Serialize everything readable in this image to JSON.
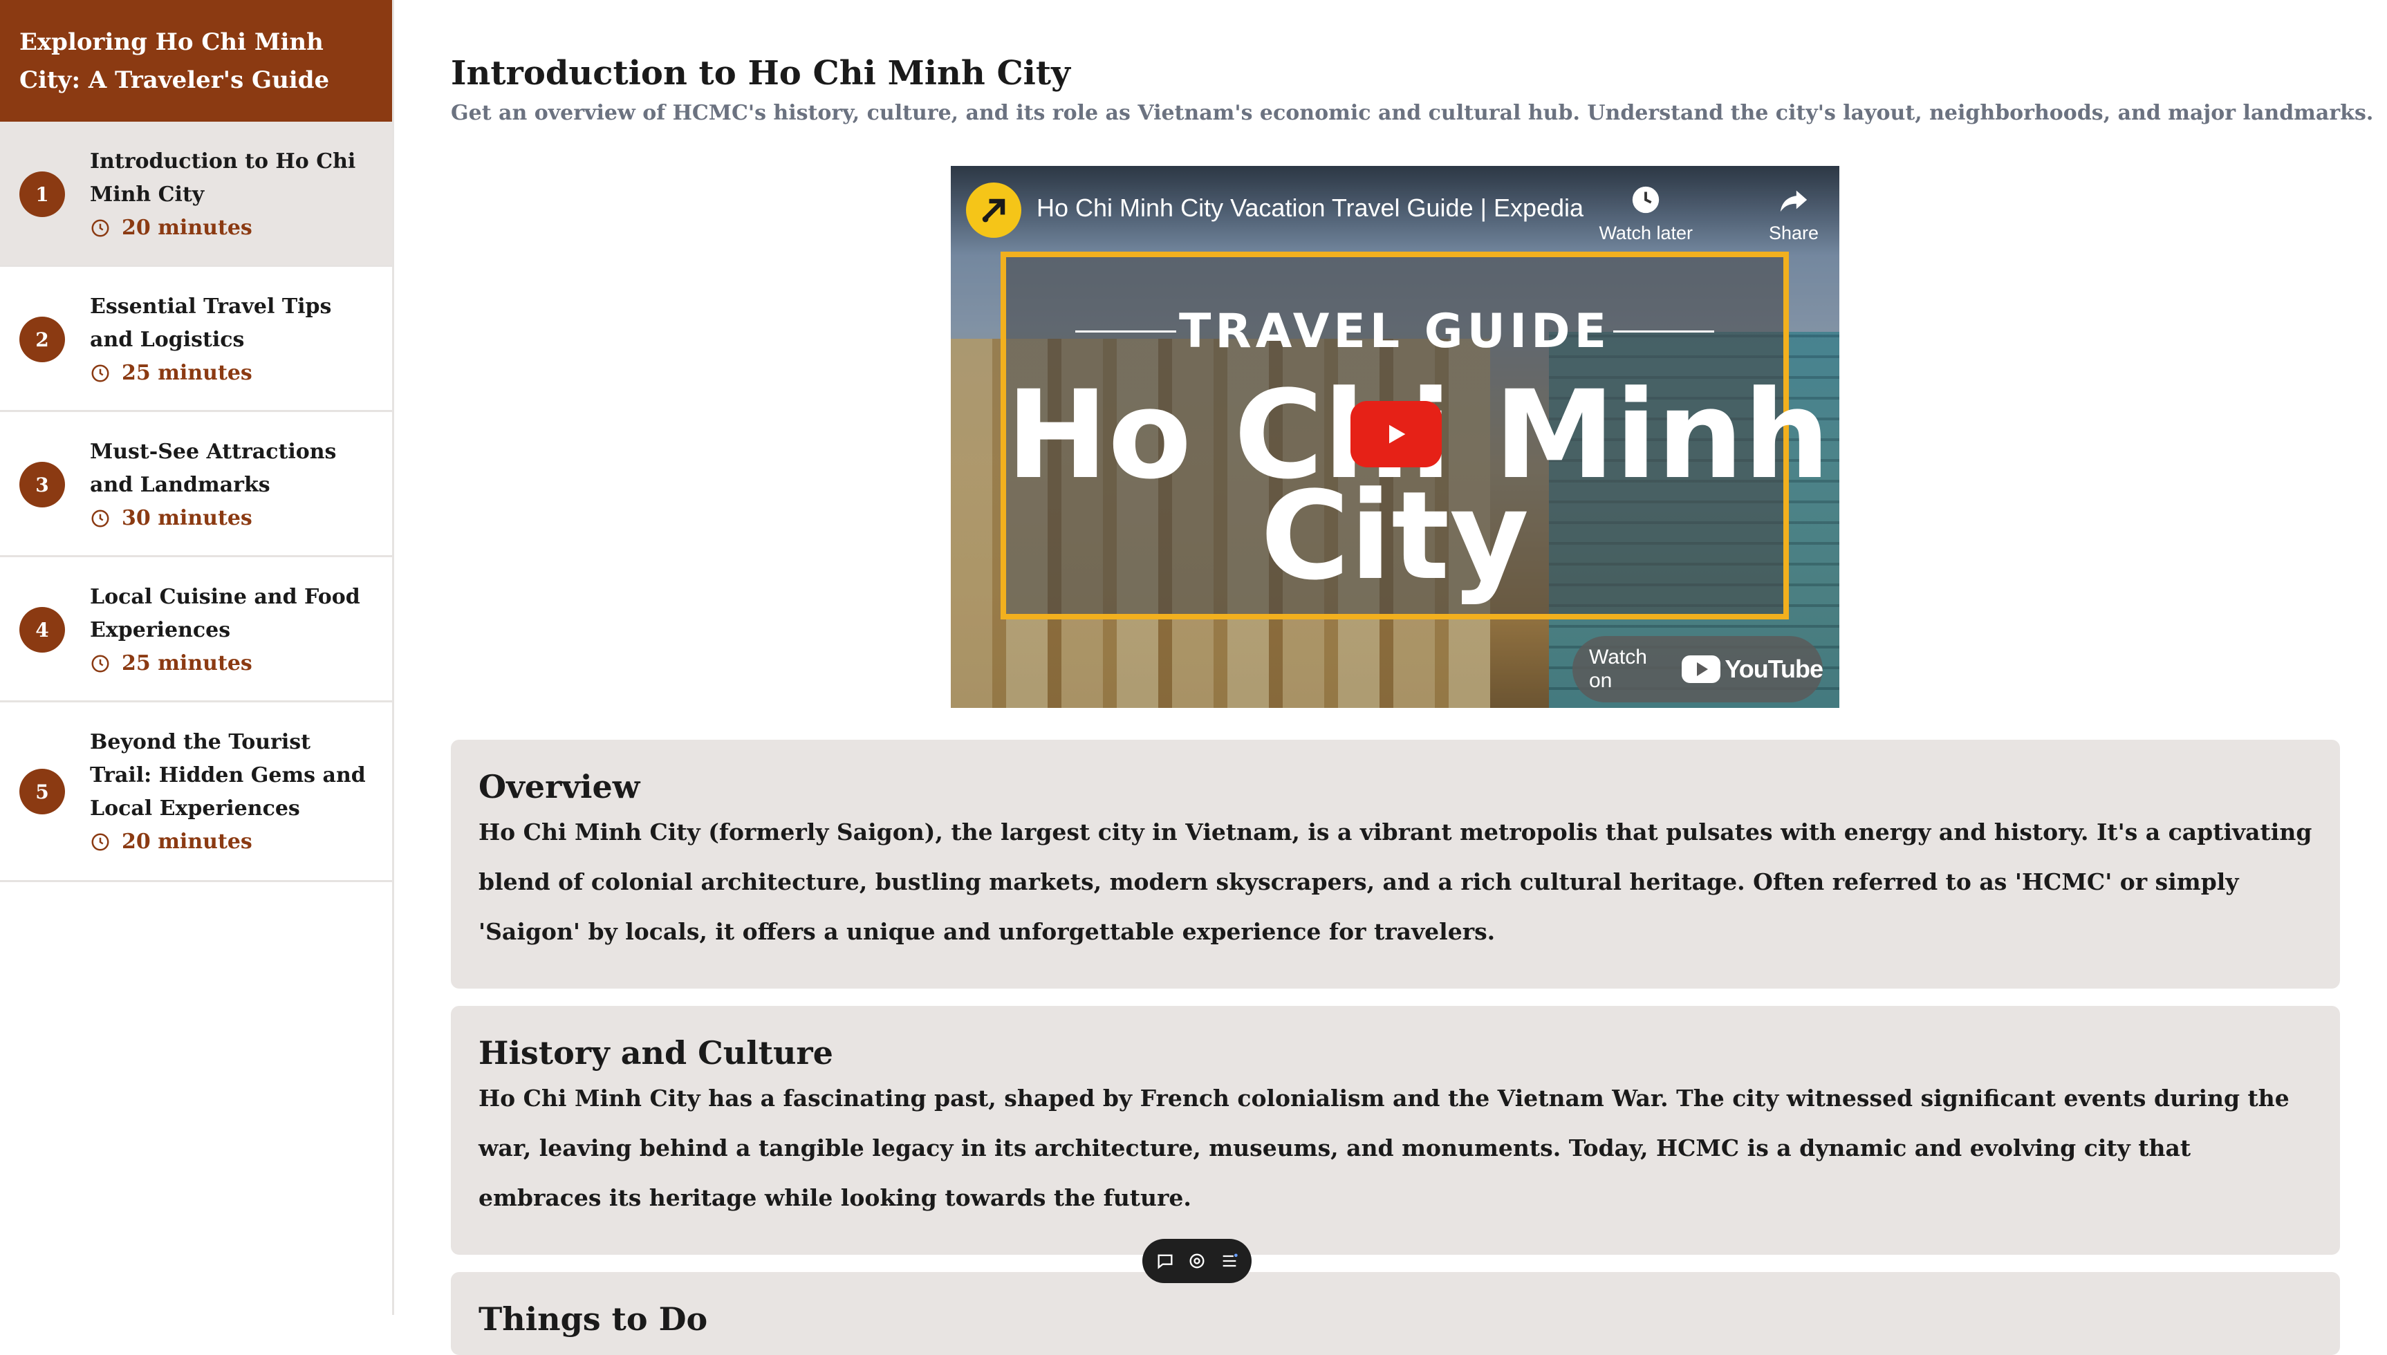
{
  "sidebar": {
    "title": "Exploring Ho Chi Minh City: A Traveler's Guide",
    "items": [
      {
        "num": "1",
        "title": "Introduction to Ho Chi Minh City",
        "duration": "20 minutes",
        "active": true
      },
      {
        "num": "2",
        "title": "Essential Travel Tips and Logistics",
        "duration": "25 minutes"
      },
      {
        "num": "3",
        "title": "Must-See Attractions and Landmarks",
        "duration": "30 minutes"
      },
      {
        "num": "4",
        "title": "Local Cuisine and Food Experiences",
        "duration": "25 minutes"
      },
      {
        "num": "5",
        "title": "Beyond the Tourist Trail: Hidden Gems and Local Experiences",
        "duration": "20 minutes"
      }
    ]
  },
  "main": {
    "title": "Introduction to Ho Chi Minh City",
    "subtitle": "Get an overview of HCMC's history, culture, and its role as Vietnam's economic and cultural hub. Understand the city's layout, neighborhoods, and major landmarks."
  },
  "video": {
    "title": "Ho Chi Minh City Vacation Travel Guide | Expedia",
    "watch_later": "Watch later",
    "share": "Share",
    "thumb_heading": "TRAVEL GUIDE",
    "thumb_line1": "Ho Chi Minh",
    "thumb_line2": "City",
    "watch_on": "Watch on",
    "youtube": "YouTube"
  },
  "sections": [
    {
      "heading": "Overview",
      "body": "Ho Chi Minh City (formerly Saigon), the largest city in Vietnam, is a vibrant metropolis that pulsates with energy and history. It's a captivating blend of colonial architecture, bustling markets, modern skyscrapers, and a rich cultural heritage. Often referred to as 'HCMC' or simply 'Saigon' by locals, it offers a unique and unforgettable experience for travelers."
    },
    {
      "heading": "History and Culture",
      "body": "Ho Chi Minh City has a fascinating past, shaped by French colonialism and the Vietnam War. The city witnessed significant events during the war, leaving behind a tangible legacy in its architecture, museums, and monuments. Today, HCMC is a dynamic and evolving city that embraces its heritage while looking towards the future."
    },
    {
      "heading": "Things to Do"
    }
  ],
  "colors": {
    "accent": "#8b3a12",
    "card_bg": "#e8e4e2",
    "subtitle": "#6b7280"
  },
  "toolbar": {
    "icons": [
      "comment-icon",
      "eye-icon",
      "menu-icon"
    ]
  }
}
